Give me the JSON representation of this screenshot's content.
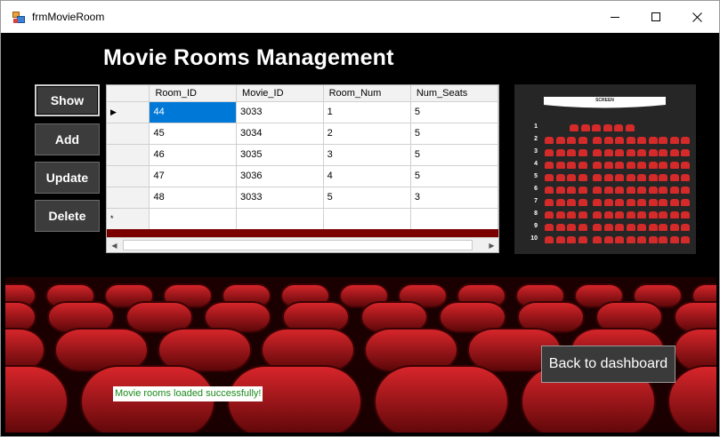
{
  "window": {
    "title": "frmMovieRoom"
  },
  "heading": "Movie Rooms Management",
  "buttons": {
    "show": "Show",
    "add": "Add",
    "update": "Update",
    "delete": "Delete",
    "back": "Back to dashboard"
  },
  "grid": {
    "columns": [
      "Room_ID",
      "Movie_ID",
      "Room_Num",
      "Num_Seats"
    ],
    "rows": [
      [
        "44",
        "3033",
        "1",
        "5"
      ],
      [
        "45",
        "3034",
        "2",
        "5"
      ],
      [
        "46",
        "3035",
        "3",
        "5"
      ],
      [
        "47",
        "3036",
        "4",
        "5"
      ],
      [
        "48",
        "3033",
        "5",
        "3"
      ]
    ],
    "current_row_marker": "▶",
    "new_row_marker": "*"
  },
  "seatmap": {
    "screen_label": "SCREEN",
    "row_numbers": [
      "1",
      "2",
      "3",
      "4",
      "5",
      "6",
      "7",
      "8",
      "9",
      "10"
    ]
  },
  "status": "Movie rooms loaded successfully!",
  "colors": {
    "background": "#000000",
    "seat": "#d42a2a",
    "status_text": "#1a8a1a",
    "selection": "#0078d7",
    "grid_dark_band": "#7a0000"
  }
}
